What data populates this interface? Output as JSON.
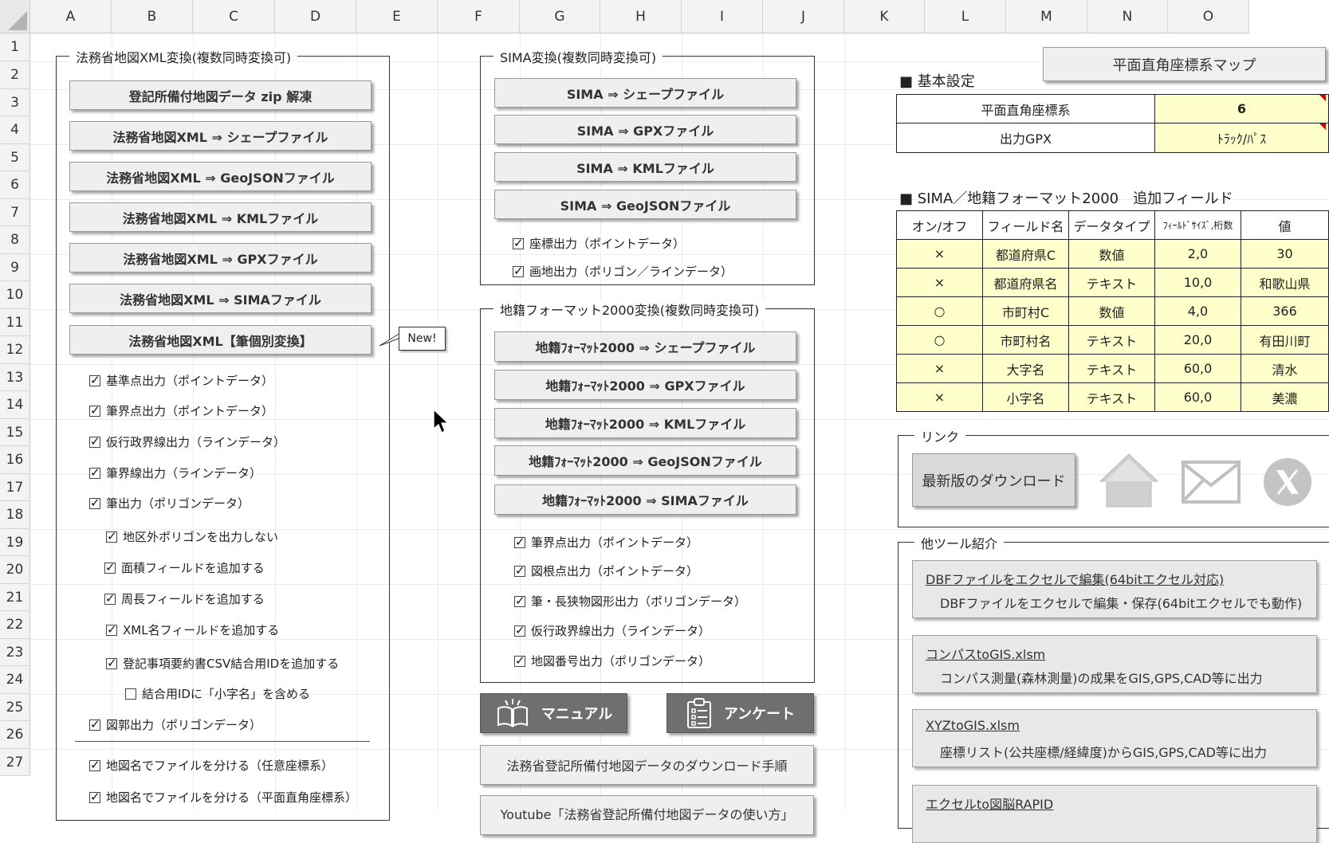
{
  "columns": [
    "A",
    "B",
    "C",
    "D",
    "E",
    "F",
    "G",
    "H",
    "I",
    "J",
    "K",
    "L",
    "M",
    "N",
    "O"
  ],
  "rows": [
    "1",
    "2",
    "3",
    "4",
    "5",
    "6",
    "7",
    "8",
    "9",
    "10",
    "11",
    "12",
    "13",
    "14",
    "15",
    "16",
    "17",
    "18",
    "19",
    "20",
    "21",
    "22",
    "23",
    "24",
    "25",
    "26",
    "27"
  ],
  "moj": {
    "title": "法務省地図XML変換(複数同時変換可)",
    "buttons": [
      "登記所備付地図データ zip 解凍",
      "法務省地図XML ⇒ シェープファイル",
      "法務省地図XML ⇒ GeoJSONファイル",
      "法務省地図XML ⇒ KMLファイル",
      "法務省地図XML ⇒ GPXファイル",
      "法務省地図XML ⇒ SIMAファイル",
      "法務省地図XML【筆個別変換】"
    ],
    "new_label": "New!",
    "options": [
      {
        "label": "基準点出力（ポイントデータ）",
        "checked": true
      },
      {
        "label": "筆界点出力（ポイントデータ）",
        "checked": true
      },
      {
        "label": "仮行政界線出力（ラインデータ）",
        "checked": true
      },
      {
        "label": "筆界線出力（ラインデータ）",
        "checked": true
      },
      {
        "label": "筆出力（ポリゴンデータ）",
        "checked": true
      },
      {
        "label": "地区外ポリゴンを出力しない",
        "checked": true
      },
      {
        "label": "面積フィールドを追加する",
        "checked": true
      },
      {
        "label": "周長フィールドを追加する",
        "checked": true
      },
      {
        "label": "XML名フィールドを追加する",
        "checked": true
      },
      {
        "label": "登記事項要約書CSV結合用IDを追加する",
        "checked": true
      },
      {
        "label": "結合用IDに「小字名」を含める",
        "checked": false
      },
      {
        "label": "図郭出力（ポリゴンデータ）",
        "checked": true
      },
      {
        "label": "地図名でファイルを分ける（任意座標系）",
        "checked": true
      },
      {
        "label": "地図名でファイルを分ける（平面直角座標系）",
        "checked": true
      }
    ]
  },
  "sima": {
    "title": "SIMA変換(複数同時変換可)",
    "buttons": [
      "SIMA ⇒ シェープファイル",
      "SIMA ⇒ GPXファイル",
      "SIMA ⇒ KMLファイル",
      "SIMA ⇒ GeoJSONファイル"
    ],
    "options": [
      {
        "label": "座標出力（ポイントデータ）",
        "checked": true
      },
      {
        "label": "画地出力（ポリゴン／ラインデータ）",
        "checked": true
      }
    ]
  },
  "chiseki": {
    "title": "地籍フォーマット2000変換(複数同時変換可)",
    "buttons": [
      "地籍ﾌｫｰﾏｯﾄ2000 ⇒ シェープファイル",
      "地籍ﾌｫｰﾏｯﾄ2000 ⇒ GPXファイル",
      "地籍ﾌｫｰﾏｯﾄ2000 ⇒ KMLファイル",
      "地籍ﾌｫｰﾏｯﾄ2000 ⇒ GeoJSONファイル",
      "地籍ﾌｫｰﾏｯﾄ2000 ⇒ SIMAファイル"
    ],
    "options": [
      {
        "label": "筆界点出力（ポイントデータ）",
        "checked": true
      },
      {
        "label": "図根点出力（ポイントデータ）",
        "checked": true
      },
      {
        "label": "筆・長狭物図形出力（ポリゴンデータ）",
        "checked": true
      },
      {
        "label": "仮行政界線出力（ラインデータ）",
        "checked": true
      },
      {
        "label": "地図番号出力（ポリゴンデータ）",
        "checked": true
      }
    ]
  },
  "bottom": {
    "manual": "マニュアル",
    "survey": "アンケート",
    "download_steps": "法務省登記所備付地図データのダウンロード手順",
    "partial": "Youtube「法務省登記所備付地図データの使い方」"
  },
  "map_button": "平面直角座標系マップ",
  "settings": {
    "heading": "■ 基本設定",
    "rows": [
      {
        "label": "平面直角座標系",
        "value": "6"
      },
      {
        "label": "出力GPX",
        "value": "ﾄﾗｯｸ/ﾊﾟｽ"
      }
    ]
  },
  "fields": {
    "heading": "■ SIMA／地籍フォーマット2000　追加フィールド",
    "headers": [
      "オン/オフ",
      "フィールド名",
      "データタイプ",
      "ﾌｨｰﾙﾄﾞｻｲｽﾞ,桁数",
      "値"
    ],
    "rows": [
      [
        "×",
        "都道府県C",
        "数値",
        "2,0",
        "30"
      ],
      [
        "×",
        "都道府県名",
        "テキスト",
        "10,0",
        "和歌山県"
      ],
      [
        "○",
        "市町村C",
        "数値",
        "4,0",
        "366"
      ],
      [
        "○",
        "市町村名",
        "テキスト",
        "20,0",
        "有田川町"
      ],
      [
        "×",
        "大字名",
        "テキスト",
        "60,0",
        "清水"
      ],
      [
        "×",
        "小字名",
        "テキスト",
        "60,0",
        "美濃"
      ]
    ]
  },
  "links": {
    "title": "リンク",
    "download": "最新版のダウンロード"
  },
  "tools": {
    "title": "他ツール紹介",
    "items": [
      {
        "name": "DBFファイルをエクセルで編集(64bitエクセル対応)",
        "desc": "DBFファイルをエクセルで編集・保存(64bitエクセルでも動作)"
      },
      {
        "name": "コンパスtoGIS.xlsm",
        "desc": "コンパス測量(森林測量)の成果をGIS,GPS,CAD等に出力"
      },
      {
        "name": "XYZtoGIS.xlsm",
        "desc": "座標リスト(公共座標/経緯度)からGIS,GPS,CAD等に出力"
      },
      {
        "name": "エクセルto図脳RAPID",
        "desc": ""
      }
    ]
  }
}
